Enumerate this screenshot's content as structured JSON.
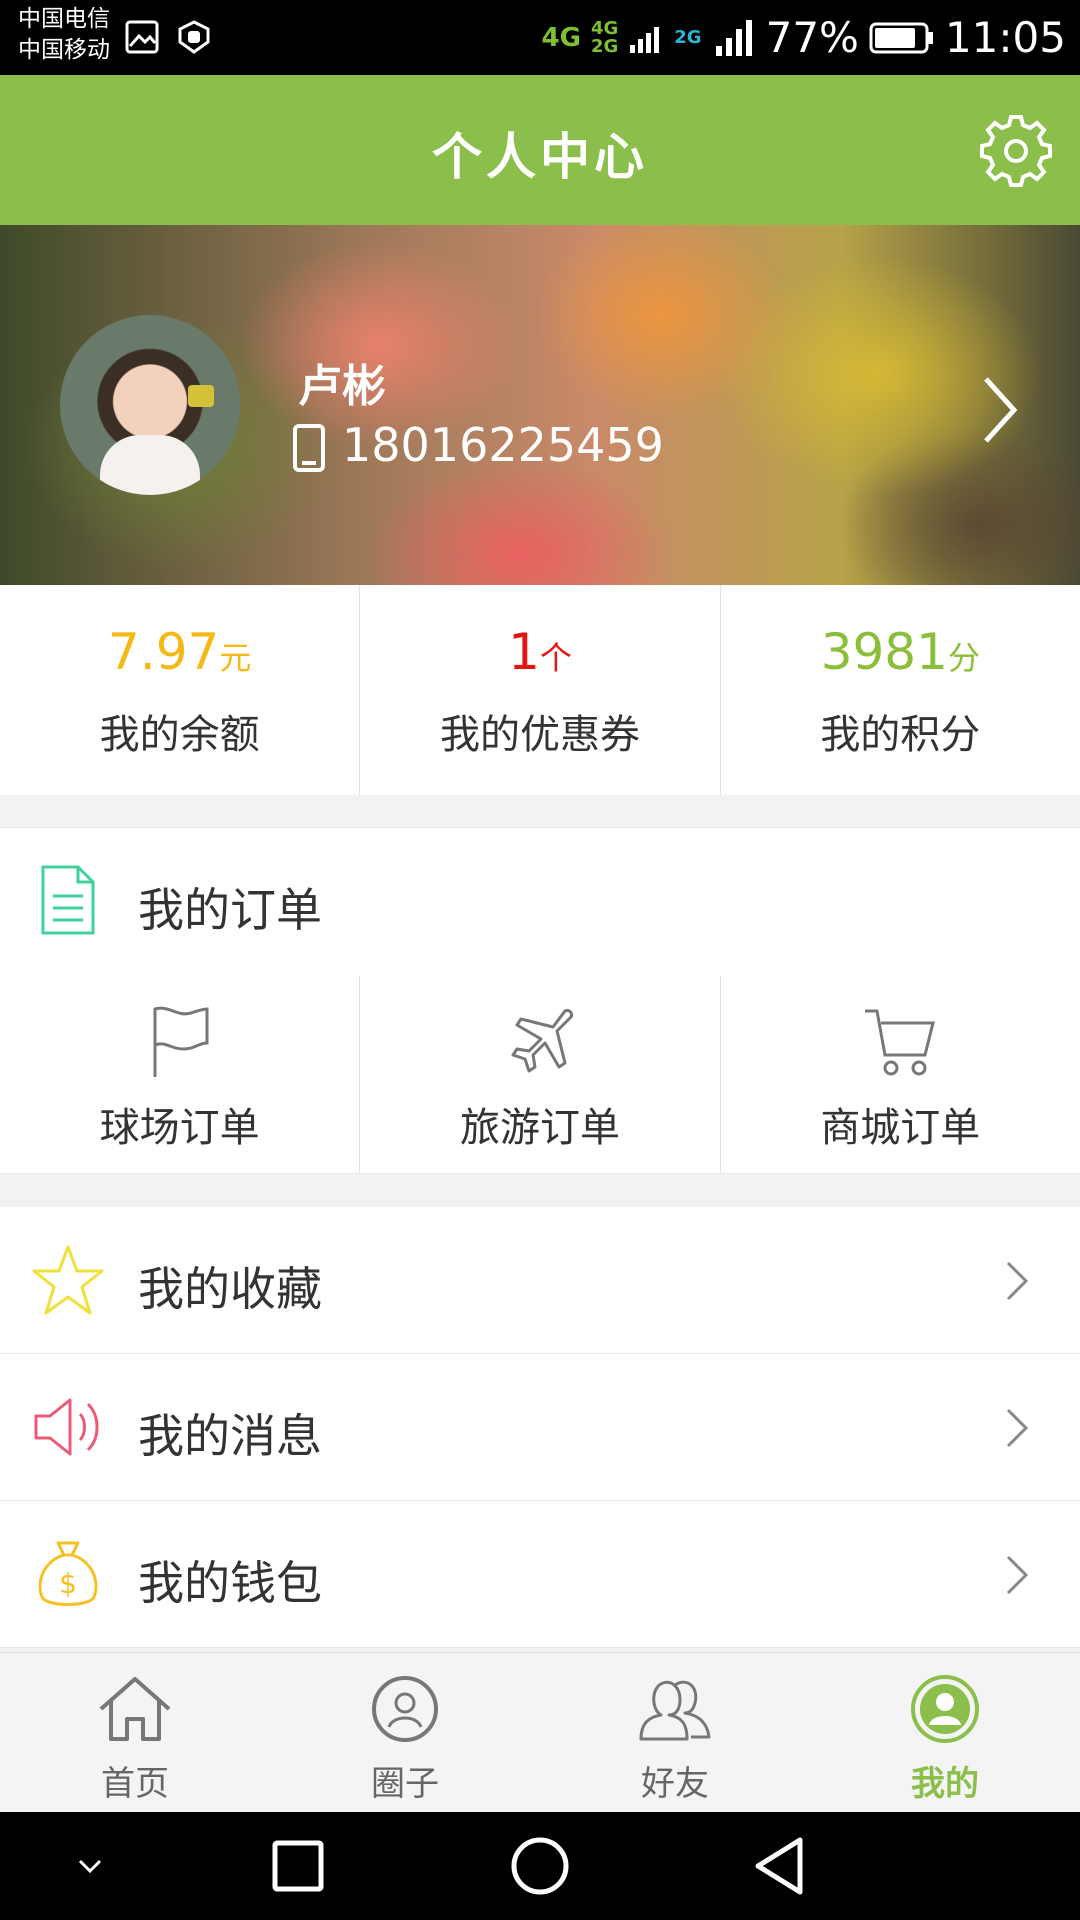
{
  "status_bar": {
    "carrier1": "中国电信",
    "carrier2": "中国移动",
    "network1": "4G",
    "network2": "4G",
    "network2b": "2G",
    "network3": "2G",
    "battery": "77%",
    "time": "11:05"
  },
  "header": {
    "title": "个人中心",
    "settings_icon": "gear-icon"
  },
  "profile": {
    "name": "卢彬",
    "phone": "18016225459"
  },
  "stats": [
    {
      "value": "7.97",
      "unit": "元",
      "label": "我的余额",
      "color": "#f5b915"
    },
    {
      "value": "1",
      "unit": "个",
      "label": "我的优惠券",
      "color": "#e81414"
    },
    {
      "value": "3981",
      "unit": "分",
      "label": "我的积分",
      "color": "#8bbe3a"
    }
  ],
  "orders": {
    "title": "我的订单",
    "items": [
      {
        "label": "球场订单",
        "icon": "flag-icon"
      },
      {
        "label": "旅游订单",
        "icon": "airplane-icon"
      },
      {
        "label": "商城订单",
        "icon": "cart-icon"
      }
    ]
  },
  "menu": [
    {
      "label": "我的收藏",
      "icon": "star-icon"
    },
    {
      "label": "我的消息",
      "icon": "speaker-icon"
    },
    {
      "label": "我的钱包",
      "icon": "money-bag-icon"
    }
  ],
  "tabs": [
    {
      "label": "首页",
      "icon": "home-icon",
      "active": false
    },
    {
      "label": "圈子",
      "icon": "circle-icon",
      "active": false
    },
    {
      "label": "好友",
      "icon": "friends-icon",
      "active": false
    },
    {
      "label": "我的",
      "icon": "profile-icon",
      "active": true
    }
  ],
  "colors": {
    "accent": "#8bbe4b"
  }
}
